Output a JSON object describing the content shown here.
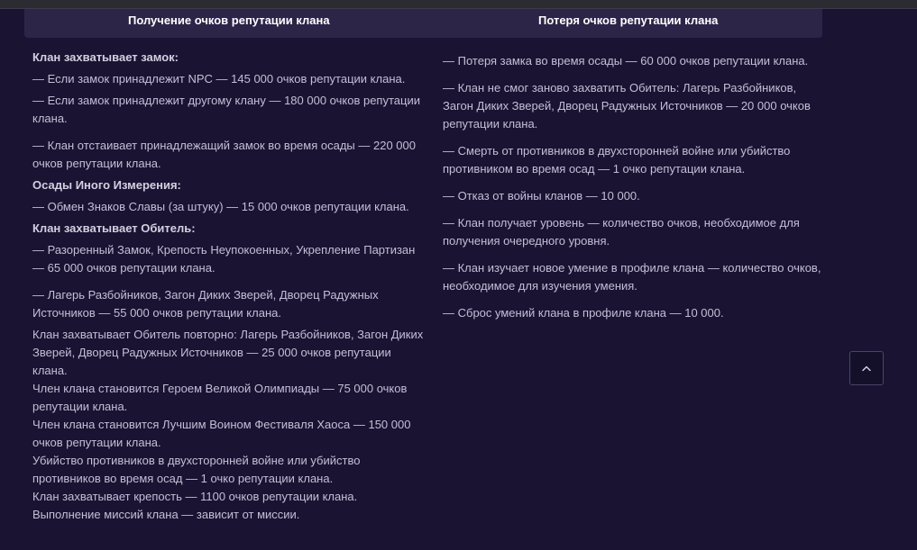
{
  "table": {
    "headers": {
      "gain": "Получение очков репутации клана",
      "loss": "Потеря очков репутации клана"
    },
    "gain": {
      "castle": {
        "heading": "Клан захватывает замок:",
        "items": [
          "— Если замок принадлежит NPC — 145 000 очков репутации клана.",
          "— Если замок принадлежит другому клану — 180 000 очков репутации клана.",
          "— Клан отстаивает принадлежащий замок во время осады — 220 000 очков репутации клана."
        ]
      },
      "dimension": {
        "heading": "Осады Иного Измерения:",
        "items": [
          "— Обмен Знаков Славы (за штуку) — 15 000 очков репутации клана."
        ]
      },
      "abode": {
        "heading": "Клан захватывает Обитель:",
        "items": [
          "— Разоренный Замок, Крепость Неупокоенных, Укрепление Партизан — 65 000 очков репутации клана.",
          "— Лагерь Разбойников, Загон Диких Зверей, Дворец Радужных Источников — 55 000 очков репутации клана."
        ]
      },
      "plain": [
        "Клан захватывает Обитель повторно: Лагерь Разбойников, Загон Диких Зверей, Дворец Радужных Источников — 25 000 очков репутации клана.",
        "Член клана становится Героем Великой Олимпиады — 75 000 очков репутации клана.",
        "Член клана становится Лучшим Воином Фестиваля Хаоса — 150 000 очков репутации клана.",
        "Убийство противников в двухсторонней войне или убийство противников во время осад — 1 очко репутации клана.",
        "Клан захватывает крепость — 1100 очков репутации клана.",
        "Выполнение миссий клана — зависит от миссии."
      ]
    },
    "loss": [
      "— Потеря замка во время осады — 60 000 очков репутации клана.",
      "— Клан не смог заново захватить Обитель: Лагерь Разбойников, Загон Диких Зверей, Дворец Радужных Источников — 20 000 очков репутации клана.",
      "— Смерть от противников в двухсторонней войне или убийство противником во время осад — 1 очко репутации клана.",
      "— Отказ от войны кланов — 10 000.",
      "— Клан получает уровень — количество очков, необходимое для получения очередного уровня.",
      "— Клан изучает новое умение в профиле клана — количество очков, необходимое для изучения умения.",
      "— Сброс умений клана в профиле клана — 10 000."
    ]
  },
  "scroll_top_icon": "chevron-up-icon",
  "colors": {
    "background": "#1a1332",
    "header": "#2c2548",
    "text": "#c3bfd6"
  }
}
